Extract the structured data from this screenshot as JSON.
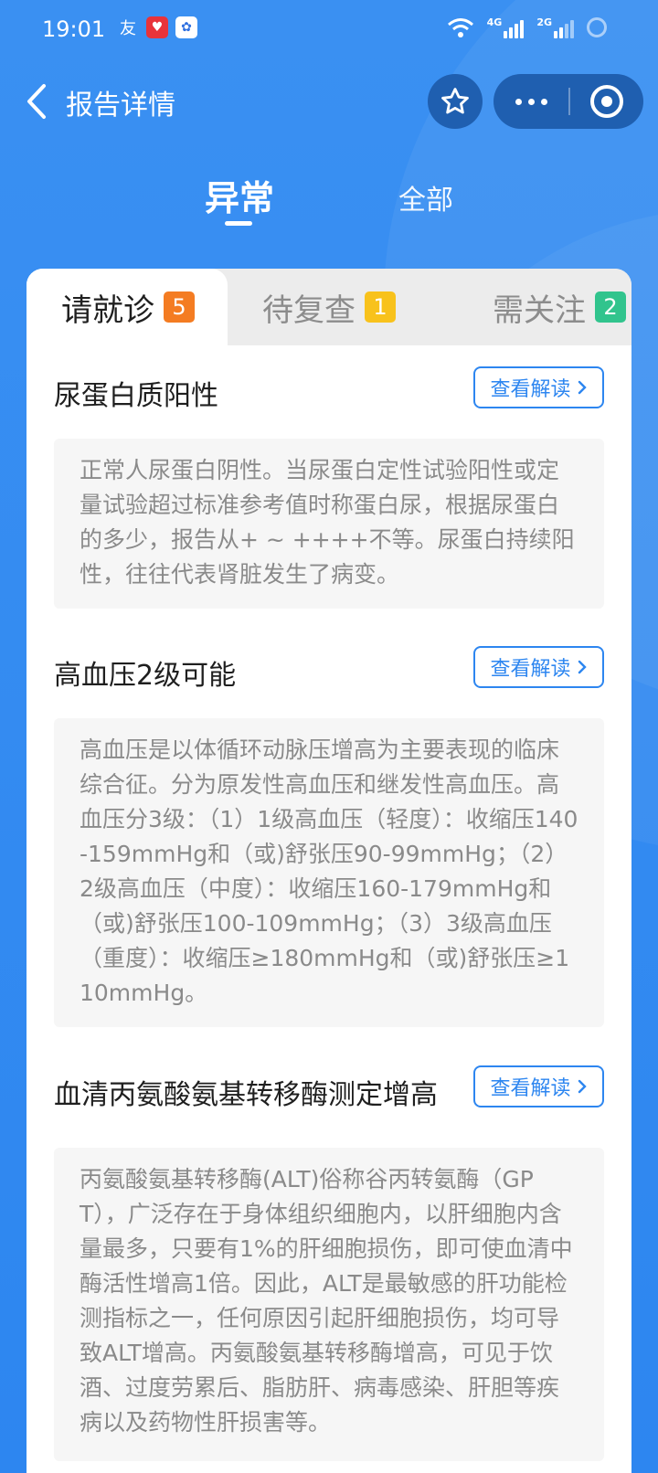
{
  "status_bar": {
    "time": "19:01",
    "app_icons": [
      "friend-icon",
      "health-icon",
      "baidu-icon"
    ],
    "network_1": "4G",
    "network_2": "2G"
  },
  "nav": {
    "title": "报告详情",
    "icons": [
      "back-arrow-icon",
      "star-icon",
      "more-icon",
      "target-icon"
    ]
  },
  "tabs": {
    "abnormal": "异常",
    "all": "全部",
    "selected": "异常"
  },
  "sub_tabs": [
    {
      "label": "请就诊",
      "count": "5",
      "color": "#f47c22"
    },
    {
      "label": "待复查",
      "count": "1",
      "color": "#f8c21c"
    },
    {
      "label": "需关注",
      "count": "2",
      "color": "#31c48d"
    }
  ],
  "colors": {
    "primary": "#2d86f0",
    "header_bg": "#3a90f2",
    "capsule_bg": "#1f5fb0"
  },
  "items": [
    {
      "title": "尿蛋白质阳性",
      "button_label": "查看解读",
      "description": "正常人尿蛋白阴性。当尿蛋白定性试验阳性或定量试验超过标准参考值时称蛋白尿，根据尿蛋白的多少，报告从+ ~ ++++不等。尿蛋白持续阳性，往往代表肾脏发生了病变。"
    },
    {
      "title": "高血压2级可能",
      "button_label": "查看解读",
      "description": "高血压是以体循环动脉压增高为主要表现的临床综合征。分为原发性高血压和继发性高血压。高血压分3级：（1）1级高血压（轻度）：收缩压140-159mmHg和（或)舒张压90-99mmHg；（2）2级高血压（中度）：收缩压160-179mmHg和（或)舒张压100-109mmHg；（3）3级高血压（重度）：收缩压≥180mmHg和（或)舒张压≥110mmHg。"
    },
    {
      "title": "血清丙氨酸氨基转移酶测定增高",
      "button_label": "查看解读",
      "description": "丙氨酸氨基转移酶(ALT)俗称谷丙转氨酶（GPT），广泛存在于身体组织细胞内，以肝细胞内含量最多，只要有1%的肝细胞损伤，即可使血清中酶活性增高1倍。因此，ALT是最敏感的肝功能检测指标之一，任何原因引起肝细胞损伤，均可导致ALT增高。丙氨酸氨基转移酶增高，可见于饮酒、过度劳累后、脂肪肝、病毒感染、肝胆等疾病以及药物性肝损害等。"
    }
  ]
}
